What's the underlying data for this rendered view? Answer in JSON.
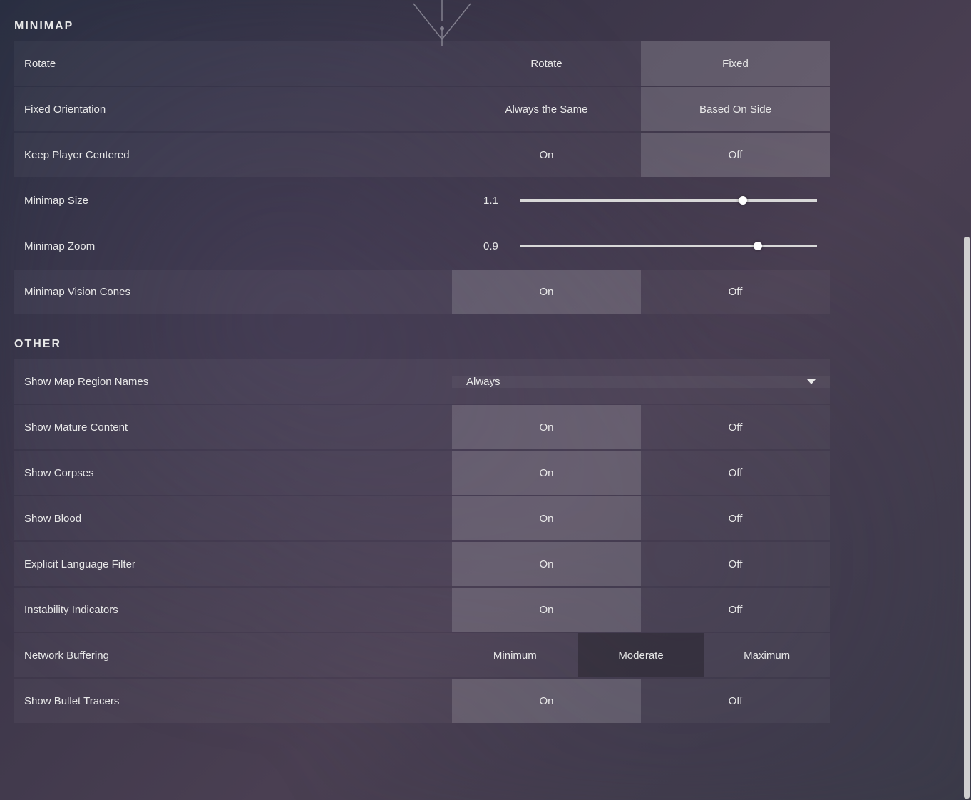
{
  "sections": {
    "minimap": {
      "title": "MINIMAP",
      "rotate": {
        "label": "Rotate",
        "options": [
          "Rotate",
          "Fixed"
        ],
        "selected": 1
      },
      "fixed_orientation": {
        "label": "Fixed Orientation",
        "options": [
          "Always the Same",
          "Based On Side"
        ],
        "selected": 1
      },
      "keep_player_centered": {
        "label": "Keep Player Centered",
        "options": [
          "On",
          "Off"
        ],
        "selected": 1
      },
      "minimap_size": {
        "label": "Minimap Size",
        "value": "1.1",
        "percent": 75
      },
      "minimap_zoom": {
        "label": "Minimap Zoom",
        "value": "0.9",
        "percent": 80
      },
      "minimap_vision_cones": {
        "label": "Minimap Vision Cones",
        "options": [
          "On",
          "Off"
        ],
        "selected": 0
      }
    },
    "other": {
      "title": "OTHER",
      "show_map_region_names": {
        "label": "Show Map Region Names",
        "value": "Always"
      },
      "show_mature_content": {
        "label": "Show Mature Content",
        "options": [
          "On",
          "Off"
        ],
        "selected": 0
      },
      "show_corpses": {
        "label": "Show Corpses",
        "options": [
          "On",
          "Off"
        ],
        "selected": 0
      },
      "show_blood": {
        "label": "Show Blood",
        "options": [
          "On",
          "Off"
        ],
        "selected": 0
      },
      "explicit_language_filter": {
        "label": "Explicit Language Filter",
        "options": [
          "On",
          "Off"
        ],
        "selected": 0
      },
      "instability_indicators": {
        "label": "Instability Indicators",
        "options": [
          "On",
          "Off"
        ],
        "selected": 0
      },
      "network_buffering": {
        "label": "Network Buffering",
        "options": [
          "Minimum",
          "Moderate",
          "Maximum"
        ],
        "selected": 1
      },
      "show_bullet_tracers": {
        "label": "Show Bullet Tracers",
        "options": [
          "On",
          "Off"
        ],
        "selected": 0
      }
    }
  }
}
